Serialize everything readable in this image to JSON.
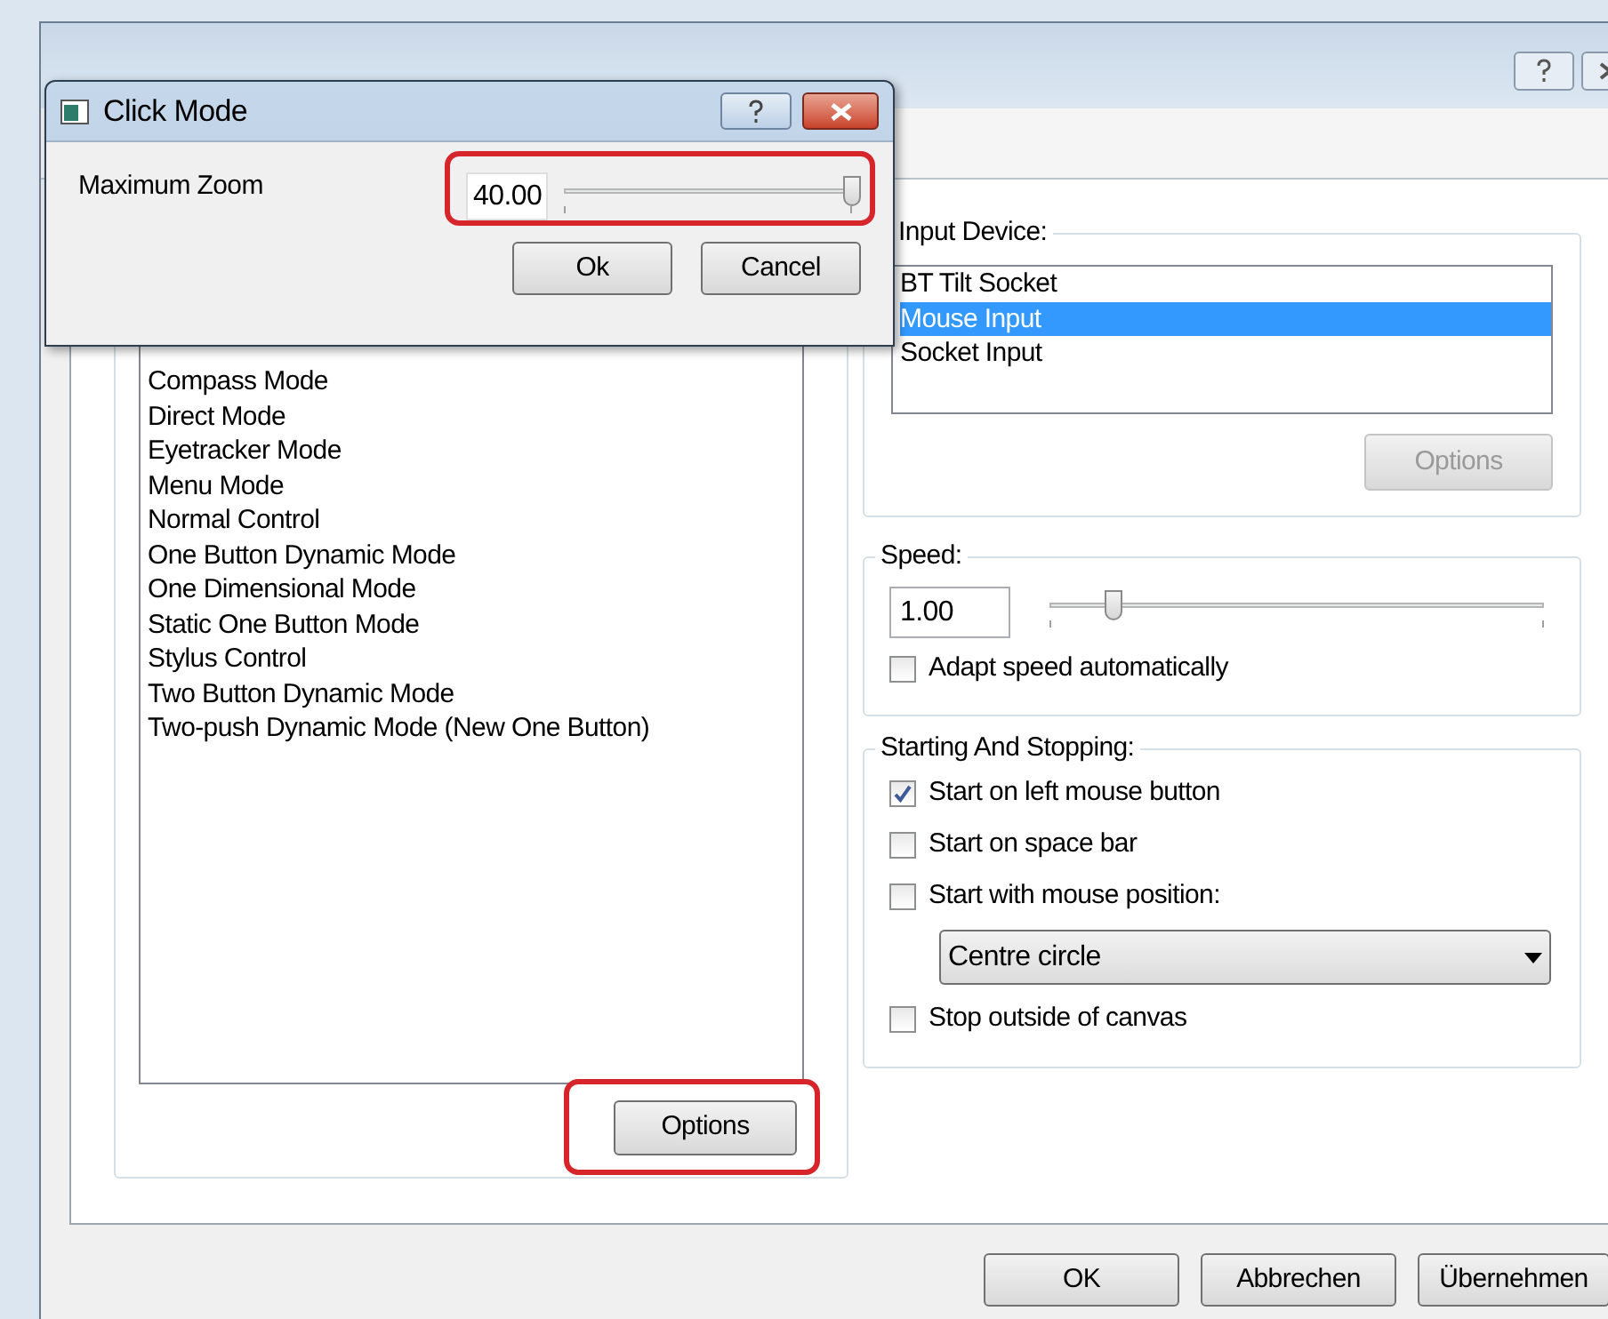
{
  "preferences": {
    "click_mode_list": {
      "items": [
        {
          "label": "Compass Mode",
          "selected": false
        },
        {
          "label": "Direct Mode",
          "selected": false
        },
        {
          "label": "Eyetracker Mode",
          "selected": false
        },
        {
          "label": "Menu Mode",
          "selected": false
        },
        {
          "label": "Normal Control",
          "selected": false
        },
        {
          "label": "One Button Dynamic Mode",
          "selected": false
        },
        {
          "label": "One Dimensional Mode",
          "selected": false
        },
        {
          "label": "Static One Button Mode",
          "selected": false
        },
        {
          "label": "Stylus Control",
          "selected": false
        },
        {
          "label": "Two Button Dynamic Mode",
          "selected": false
        },
        {
          "label": "Two-push Dynamic Mode (New One Button)",
          "selected": false
        }
      ],
      "options_button": {
        "label": "Options",
        "highlighted": true
      }
    },
    "input_device": {
      "title": "Input Device:",
      "items": [
        {
          "label": "BT Tilt Socket",
          "selected": false
        },
        {
          "label": "Mouse Input",
          "selected": true
        },
        {
          "label": "Socket Input",
          "selected": false
        }
      ],
      "options_button": {
        "label": "Options",
        "disabled": true
      }
    },
    "speed": {
      "title": "Speed:",
      "value": "1.00",
      "level": 0.13,
      "adapt_checkbox": {
        "label": "Adapt speed automatically",
        "checked": false
      }
    },
    "starting_and_stopping": {
      "title": "Starting And Stopping:",
      "options": [
        {
          "kind": "checkbox",
          "label": "Start on left mouse button",
          "checked": true
        },
        {
          "kind": "checkbox",
          "label": "Start on space bar",
          "checked": false
        },
        {
          "kind": "checkbox",
          "label": "Start with mouse position:",
          "checked": false
        },
        {
          "kind": "dropdown",
          "value": "Centre circle"
        },
        {
          "kind": "checkbox",
          "label": "Stop outside of canvas",
          "checked": false
        }
      ]
    },
    "buttons": [
      "OK",
      "Abbrechen",
      "Übernehmen"
    ]
  },
  "click_mode_dialog": {
    "title": "Click Mode",
    "label": "Maximum Zoom",
    "value": "40.00",
    "level": 1,
    "highlighted": true,
    "buttons": [
      "Ok",
      "Cancel"
    ]
  }
}
